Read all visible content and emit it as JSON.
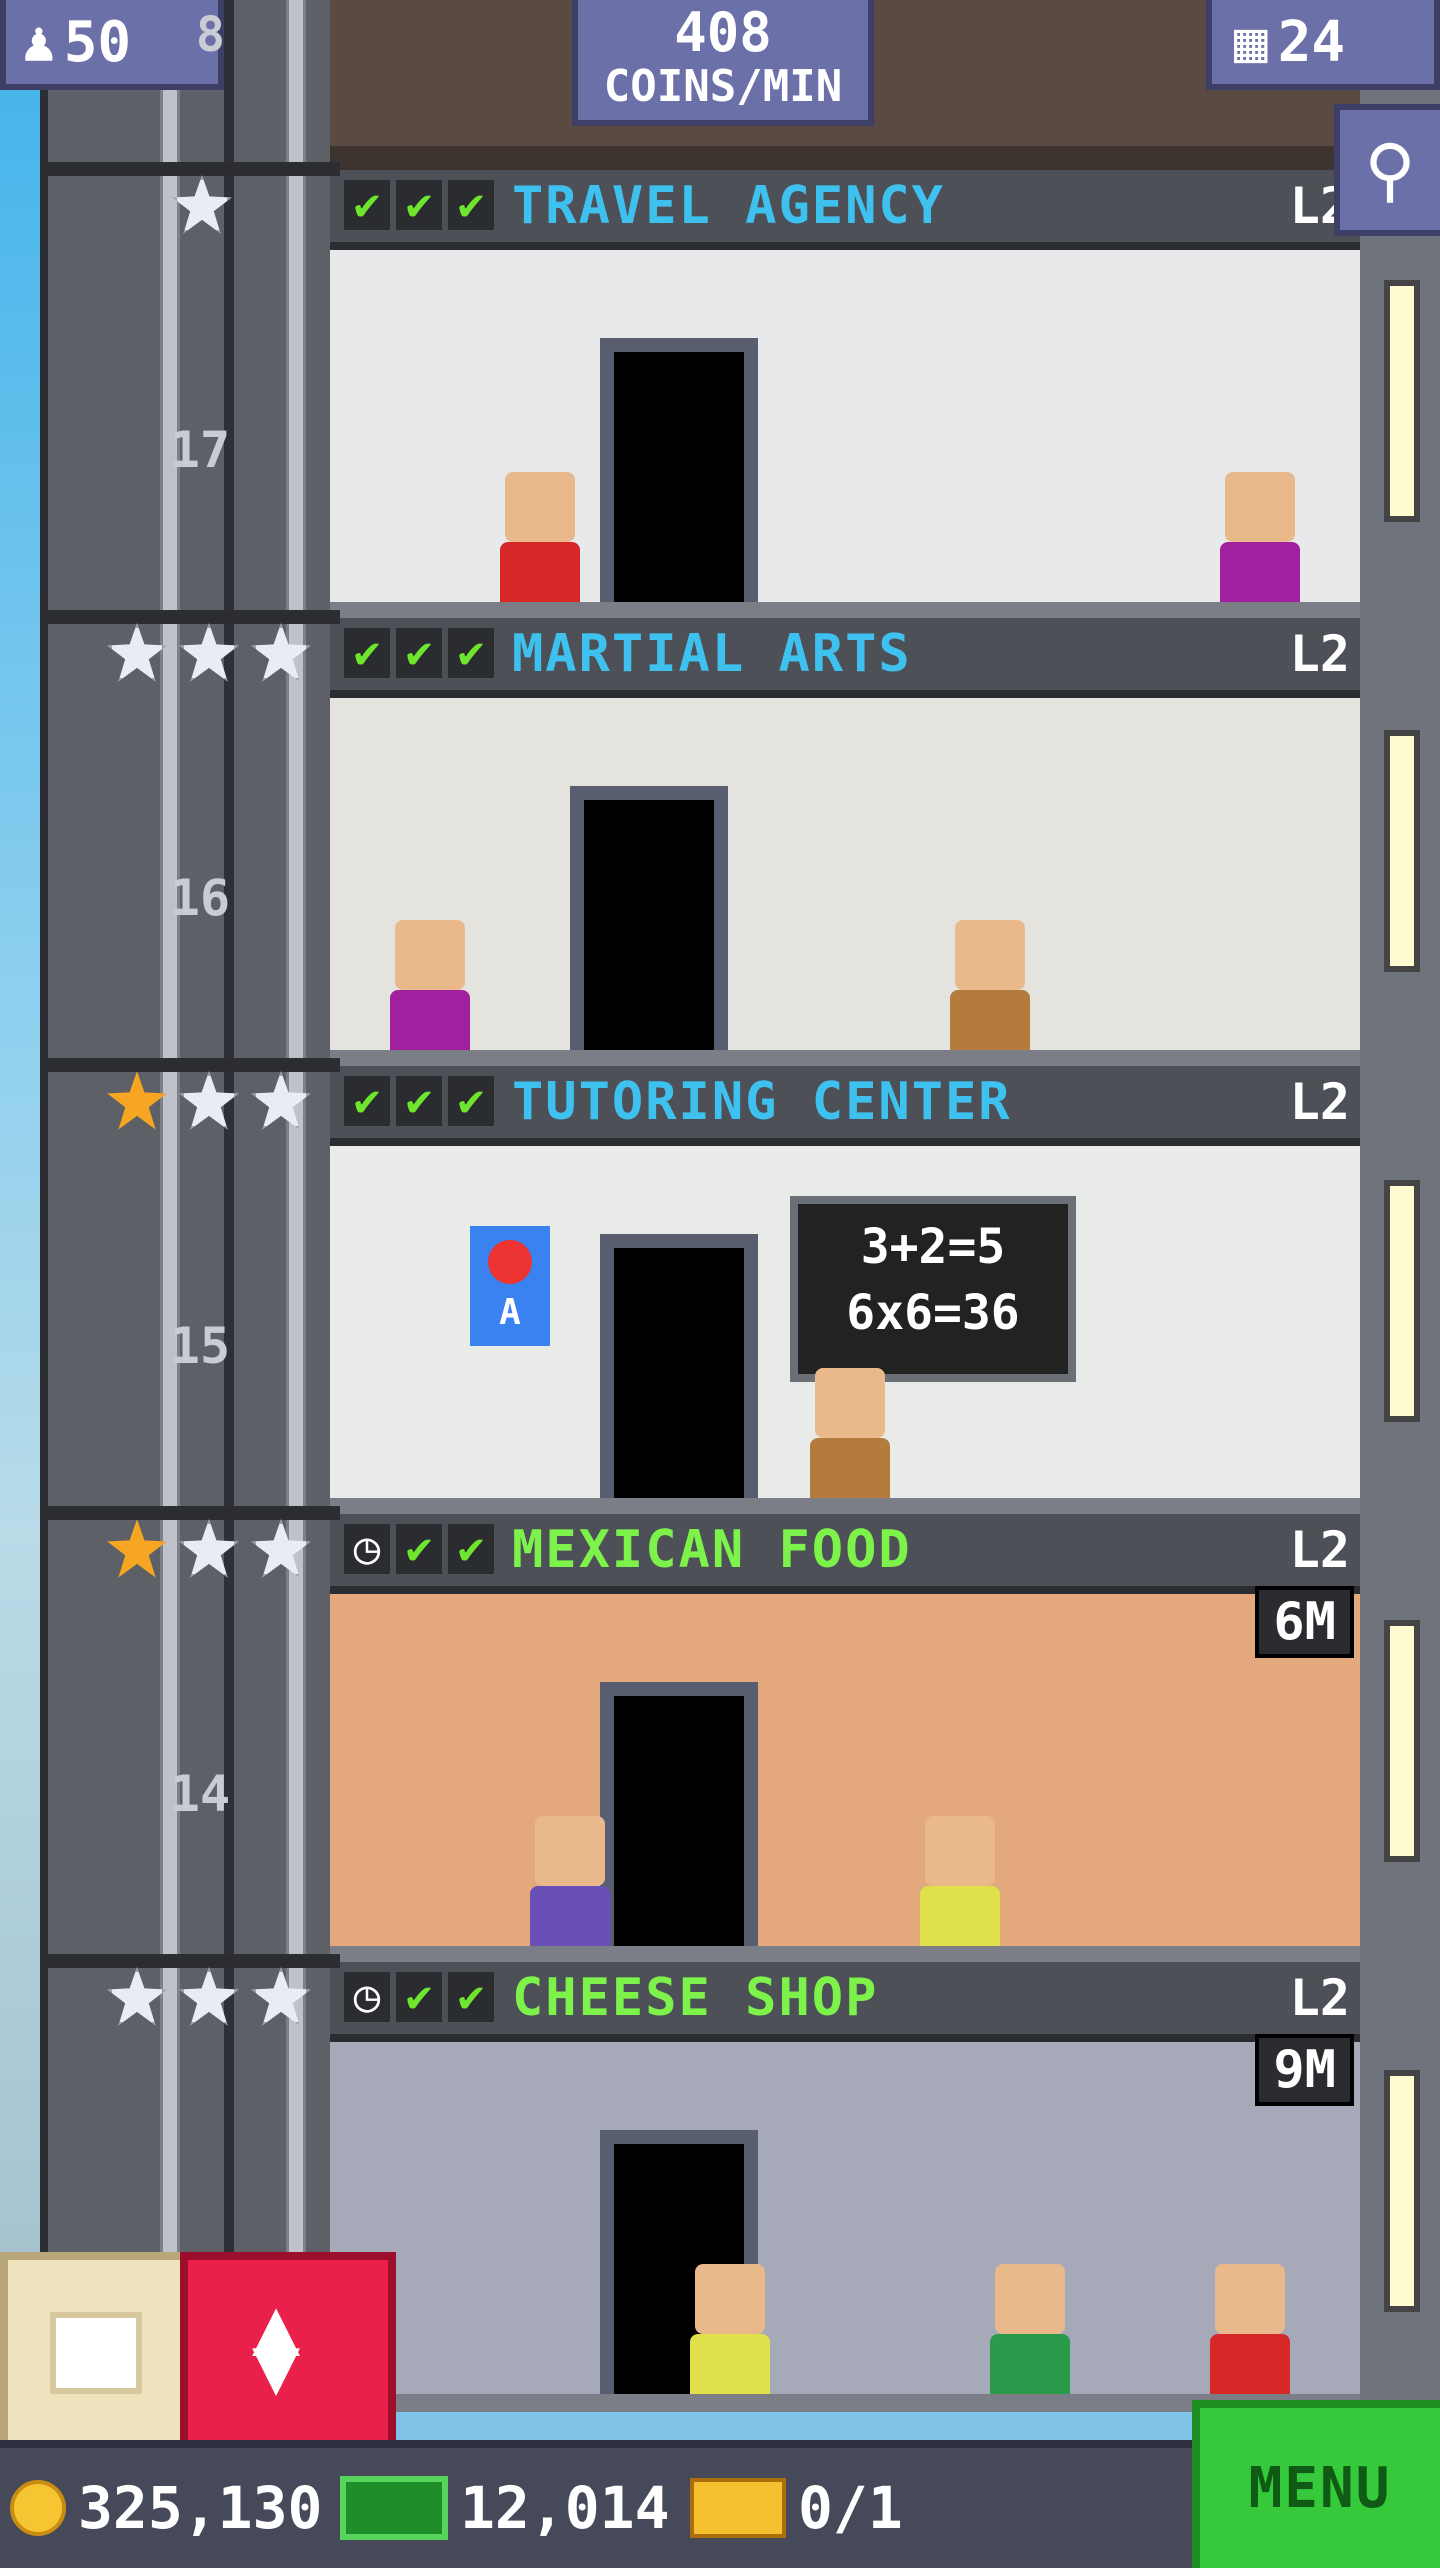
{
  "hud": {
    "population": "50",
    "coins_rate_value": "408",
    "coins_rate_unit": "COINS/MIN",
    "floors": "24",
    "shaft_top_floor_number": "8"
  },
  "floors": [
    {
      "number": "17",
      "name": "TRAVEL AGENCY",
      "level": "L2",
      "stars": [
        "off"
      ],
      "status": [
        "check",
        "check",
        "check"
      ],
      "timer": ""
    },
    {
      "number": "16",
      "name": "MARTIAL ARTS",
      "level": "L2",
      "stars": [
        "off",
        "off",
        "off"
      ],
      "status": [
        "check",
        "check",
        "check"
      ],
      "timer": ""
    },
    {
      "number": "15",
      "name": "TUTORING CENTER",
      "level": "L2",
      "stars": [
        "on",
        "off",
        "off"
      ],
      "status": [
        "check",
        "check",
        "check"
      ],
      "timer": "",
      "blackboard": [
        "3+2=5",
        "6x6=36"
      ],
      "poster_letter": "A"
    },
    {
      "number": "14",
      "name": "MEXICAN FOOD",
      "level": "L2",
      "stars": [
        "on",
        "off",
        "off"
      ],
      "status": [
        "clock",
        "check",
        "check"
      ],
      "timer": "6M"
    },
    {
      "number": "",
      "name": "CHEESE SHOP",
      "level": "L2",
      "stars": [
        "off",
        "off",
        "off"
      ],
      "status": [
        "clock",
        "check",
        "check"
      ],
      "timer": "9M"
    }
  ],
  "bottom": {
    "coins": "325,130",
    "bux": "12,014",
    "tickets": "0/1",
    "menu_label": "MENU"
  },
  "colors": {
    "accent_blue": "#3fc1f0",
    "accent_green": "#7cf24a",
    "menu_green": "#36c93b",
    "elevator_button": "#e8204a",
    "star_gold": "#f6a623"
  }
}
